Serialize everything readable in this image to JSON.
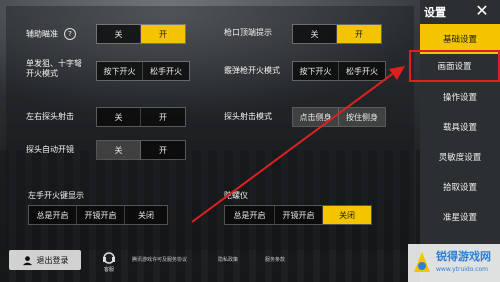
{
  "settings": {
    "aim_assist": {
      "label": "辅助瞄准",
      "help": "?",
      "opts": [
        "关",
        "开"
      ]
    },
    "muzzle_flash": {
      "label": "枪口顶端提示",
      "opts": [
        "关",
        "开"
      ]
    },
    "single_shot_mode": {
      "label": "单发狙、十字弩\n开火模式",
      "opts": [
        "按下开火",
        "松手开火"
      ]
    },
    "shotgun_mode": {
      "label": "霰弹枪开火模式",
      "opts": [
        "按下开火",
        "松手开火"
      ]
    },
    "peek_fire": {
      "label": "左右探头射击",
      "opts": [
        "关",
        "开"
      ]
    },
    "peek_mode": {
      "label": "探头射击模式",
      "opts": [
        "点击侧身",
        "按住侧身"
      ]
    },
    "auto_scope": {
      "label": "探头自动开镜",
      "opts": [
        "关",
        "开"
      ]
    },
    "left_fire": {
      "label": "左手开火键显示",
      "opts": [
        "总是开启",
        "开镜开启",
        "关闭"
      ]
    },
    "gyroscope": {
      "label": "陀螺仪",
      "opts": [
        "总是开启",
        "开镜开启",
        "关闭"
      ]
    }
  },
  "sidebar": {
    "title": "设置",
    "close": "✕",
    "items": [
      "基础设置",
      "画面设置",
      "操作设置",
      "载具设置",
      "灵敏度设置",
      "拾取设置",
      "准星设置"
    ]
  },
  "bottom": {
    "logout": "退出登录",
    "customer_service": "客服",
    "links": [
      "腾讯游戏许可及服务协议",
      "隐私政策",
      "服务条款"
    ]
  },
  "watermark": {
    "name": "锐得游戏网",
    "url": "www.ytruido.com"
  }
}
